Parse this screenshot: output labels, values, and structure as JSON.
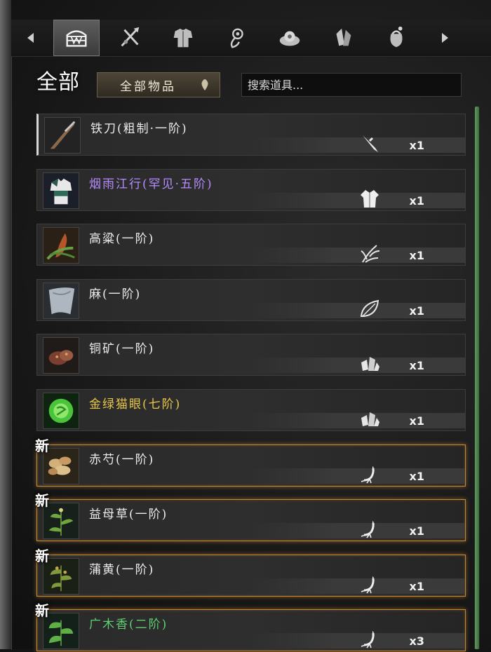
{
  "tabs": [
    {
      "name": "tab-all-chest",
      "icon": "chest-icon",
      "active": true
    },
    {
      "name": "tab-weapons",
      "icon": "crossed-swords-icon",
      "active": false
    },
    {
      "name": "tab-armor",
      "icon": "armor-icon",
      "active": false
    },
    {
      "name": "tab-accessories",
      "icon": "pendant-icon",
      "active": false
    },
    {
      "name": "tab-consumables",
      "icon": "dish-icon",
      "active": false
    },
    {
      "name": "tab-materials",
      "icon": "crystal-icon",
      "active": false
    },
    {
      "name": "tab-misc",
      "icon": "pouch-icon",
      "active": false
    }
  ],
  "filter": {
    "category_label": "全部",
    "dropdown_label": "全部物品",
    "search_placeholder": "搜索道具..."
  },
  "colors": {
    "normal": "#ececec",
    "rare": "#b58cff",
    "gold": "#e7c64a",
    "green": "#5fcf72",
    "new_glow": "#c7882f",
    "scroll": "#5d9a5d"
  },
  "new_badge": "新",
  "items": [
    {
      "name": "铁刀(粗制·一阶)",
      "count": "x1",
      "type_icon": "blade-icon",
      "color": "normal",
      "is_new": false,
      "thumb": "knife"
    },
    {
      "name": "烟雨江行(罕见·五阶)",
      "count": "x1",
      "type_icon": "robe-icon",
      "color": "rare",
      "is_new": false,
      "thumb": "armor"
    },
    {
      "name": "高粱(一阶)",
      "count": "x1",
      "type_icon": "grain-icon",
      "color": "normal",
      "is_new": false,
      "thumb": "sorghum"
    },
    {
      "name": "麻(一阶)",
      "count": "x1",
      "type_icon": "leaf-icon",
      "color": "normal",
      "is_new": false,
      "thumb": "cloth"
    },
    {
      "name": "铜矿(一阶)",
      "count": "x1",
      "type_icon": "ore-icon",
      "color": "normal",
      "is_new": false,
      "thumb": "ore"
    },
    {
      "name": "金绿猫眼(七阶)",
      "count": "x1",
      "type_icon": "ore-icon",
      "color": "gold",
      "is_new": false,
      "thumb": "gem"
    },
    {
      "name": "赤芍(一阶)",
      "count": "x1",
      "type_icon": "root-icon",
      "color": "normal",
      "is_new": true,
      "thumb": "slices"
    },
    {
      "name": "益母草(一阶)",
      "count": "x1",
      "type_icon": "root-icon",
      "color": "normal",
      "is_new": true,
      "thumb": "herb"
    },
    {
      "name": "蒲黄(一阶)",
      "count": "x1",
      "type_icon": "root-icon",
      "color": "normal",
      "is_new": true,
      "thumb": "herb2"
    },
    {
      "name": "广木香(二阶)",
      "count": "x3",
      "type_icon": "root-icon",
      "color": "green",
      "is_new": true,
      "thumb": "herb3"
    }
  ]
}
